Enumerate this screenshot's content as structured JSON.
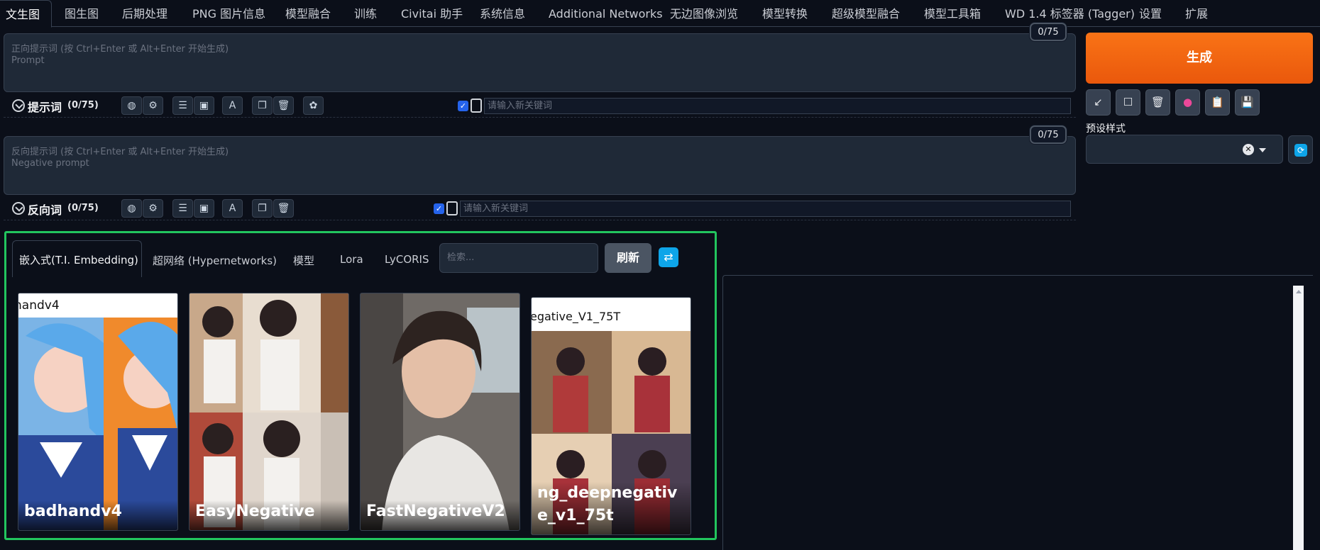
{
  "tabs": [
    "文生图",
    "图生图",
    "后期处理",
    "PNG 图片信息",
    "模型融合",
    "训练",
    "Civitai 助手",
    "系统信息",
    "Additional Networks",
    "无边图像浏览",
    "模型转换",
    "超级模型融合",
    "模型工具箱",
    "WD 1.4 标签器 (Tagger)",
    "设置",
    "扩展"
  ],
  "prompt": {
    "placeholder_cn": "正向提示词 (按 Ctrl+Enter 或 Alt+Enter 开始生成)",
    "placeholder_en": "Prompt",
    "counter": "0/75",
    "row_label": "提示词",
    "row_count": "(0/75)",
    "keyword_placeholder": "请输入新关键词"
  },
  "negative": {
    "placeholder_cn": "反向提示词 (按 Ctrl+Enter 或 Alt+Enter 开始生成)",
    "placeholder_en": "Negative prompt",
    "counter": "0/75",
    "row_label": "反向词",
    "row_count": "(0/75)",
    "keyword_placeholder": "请输入新关键词"
  },
  "generate_label": "生成",
  "action_icons": [
    "arrow-expand-icon",
    "square-icon",
    "trash-icon",
    "pink-record-icon",
    "clipboard-icon",
    "save-icon"
  ],
  "preset": {
    "label": "预设样式",
    "value": ""
  },
  "extra_networks": {
    "tabs": [
      "嵌入式(T.I. Embedding)",
      "超网络 (Hypernetworks)",
      "模型",
      "Lora",
      "LyCORIS"
    ],
    "search_placeholder": "检索...",
    "refresh_label": "刷新",
    "cards": [
      {
        "name": "badhandv4",
        "banner": "handv4"
      },
      {
        "name": "EasyNegative",
        "banner": ""
      },
      {
        "name": "FastNegativeV2",
        "banner": ""
      },
      {
        "name": "ng_deepnegative_v1_75t",
        "banner": "egative_V1_75T"
      }
    ]
  },
  "colors": {
    "accent_orange": "#ea580c",
    "highlight_green": "#22c55e",
    "background": "#0b0f19",
    "panel": "#1f2937"
  }
}
